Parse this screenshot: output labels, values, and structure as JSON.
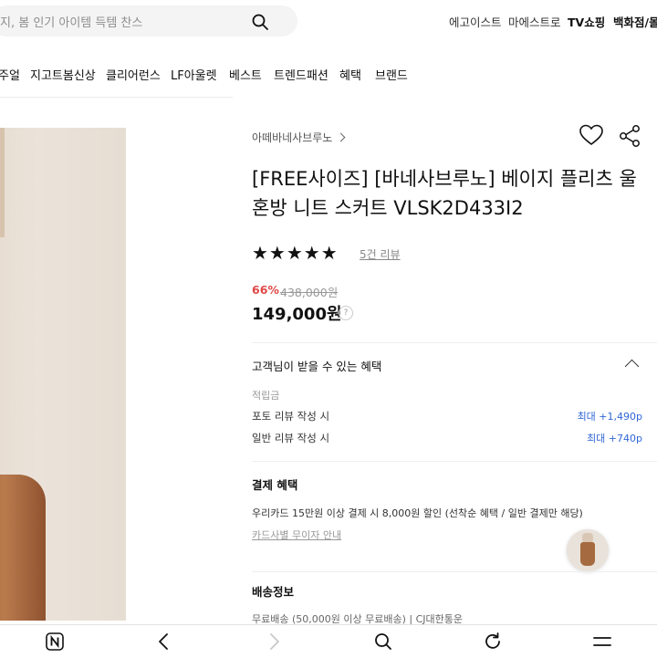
{
  "search": {
    "placeholder": "지, 봄 인기 아이템 득템 찬스"
  },
  "top_links": [
    "에고이스트",
    "마에스트로",
    "TV쇼핑",
    "백화점/몰"
  ],
  "nav": [
    "주얼",
    "지고트봄신상",
    "클리어런스",
    "LF아울렛",
    "베스트",
    "트렌드패션",
    "혜택",
    "브랜드"
  ],
  "product": {
    "brand": "아떼바네사브루노",
    "title": "[FREE사이즈] [바네사브루노] 베이지 플리츠 울혼방 니트 스커트 VLSK2D433I2",
    "rating_stars": "★★★★★",
    "rating": 5,
    "review_link": "5건 리뷰",
    "discount": "66%",
    "original_price": "438,000원",
    "price": "149,000원",
    "price_help": "?"
  },
  "benefits": {
    "header": "고객님이 받을 수 있는 혜택",
    "points_label": "적립금",
    "rows": [
      {
        "label": "포토 리뷰 작성 시",
        "value": "최대 +1,490p"
      },
      {
        "label": "일반 리뷰 작성 시",
        "value": "최대 +740p"
      }
    ]
  },
  "payment": {
    "title": "결제 혜택",
    "card_text": "우리카드 15만원 이상 결제 시 8,000원 할인 (선착순 혜택 / 일반 결제만 해당)",
    "card_link": "카드사별 무이자 안내"
  },
  "shipping": {
    "title": "배송정보",
    "row": "무료배송 (50,000원 이상 무료배송) | CJ대한통운"
  },
  "bottom_nav": [
    "naver-home-icon",
    "back-icon",
    "forward-icon",
    "search-icon",
    "refresh-icon",
    "menu-icon"
  ]
}
